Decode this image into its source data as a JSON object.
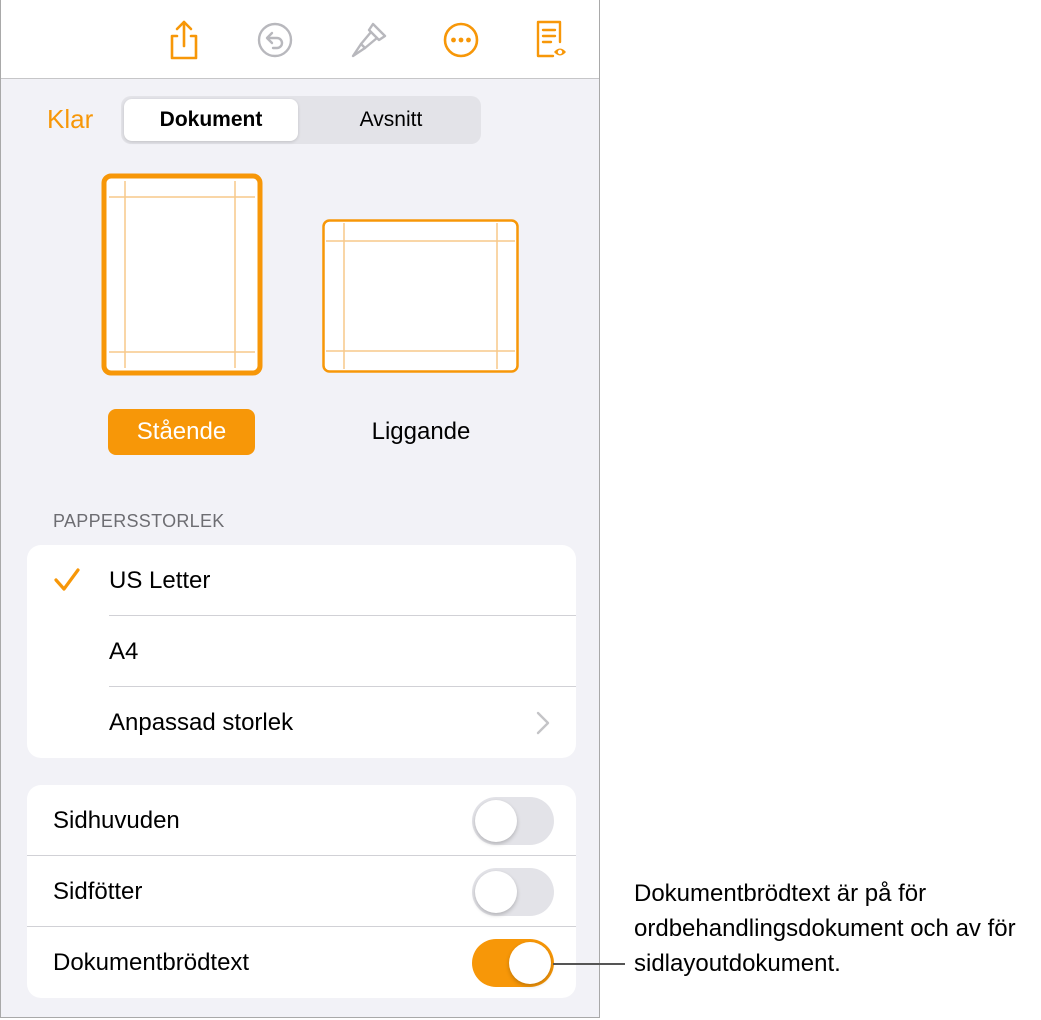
{
  "toolbar": {
    "icons": [
      "share-icon",
      "undo-icon",
      "paintbrush-icon",
      "more-icon",
      "document-setup-icon"
    ]
  },
  "header": {
    "done_label": "Klar",
    "segments": [
      "Dokument",
      "Avsnitt"
    ],
    "selected_segment": "Dokument"
  },
  "orientation": {
    "portrait_label": "Stående",
    "landscape_label": "Liggande",
    "selected": "Stående"
  },
  "paper_size": {
    "header": "PAPPERSSTORLEK",
    "options": [
      "US Letter",
      "A4",
      "Anpassad storlek"
    ],
    "selected": "US Letter"
  },
  "switches": {
    "headers_label": "Sidhuvuden",
    "headers_on": false,
    "footers_label": "Sidfötter",
    "footers_on": false,
    "body_label": "Dokumentbrödtext",
    "body_on": true
  },
  "callout": {
    "text": "Dokumentbrödtext är på för ordbehandlingsdokument och av för sidlayoutdokument."
  },
  "colors": {
    "accent": "#f79708",
    "background": "#f2f2f7",
    "separator": "#d1d1d6",
    "toggle_off": "#e3e3e8"
  }
}
